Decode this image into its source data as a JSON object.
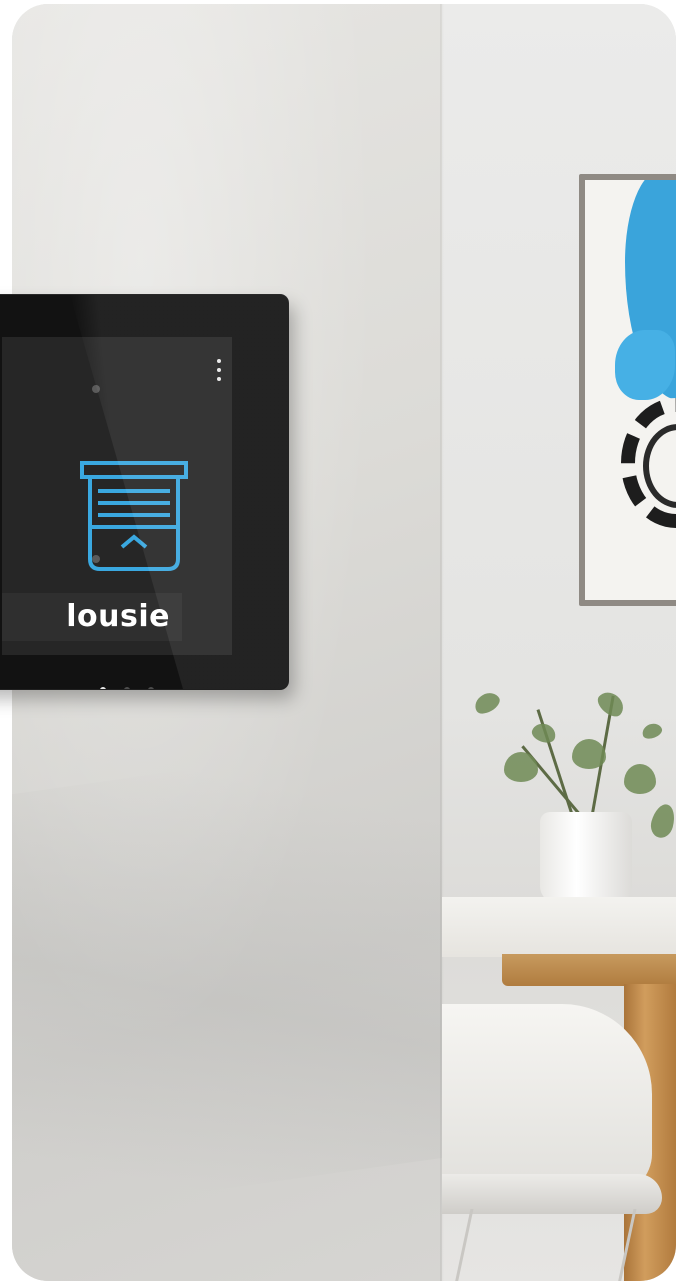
{
  "device": {
    "label": "lousie",
    "accent_color": "#3aa8e0",
    "icon": "window-blind-up-icon",
    "menu_icon": "more-vertical-icon",
    "page_indicator": {
      "pages": 3,
      "active_index": 0
    }
  },
  "colors": {
    "bezel": "#121212",
    "screen": "#262626",
    "wall": "#dddcd8"
  }
}
